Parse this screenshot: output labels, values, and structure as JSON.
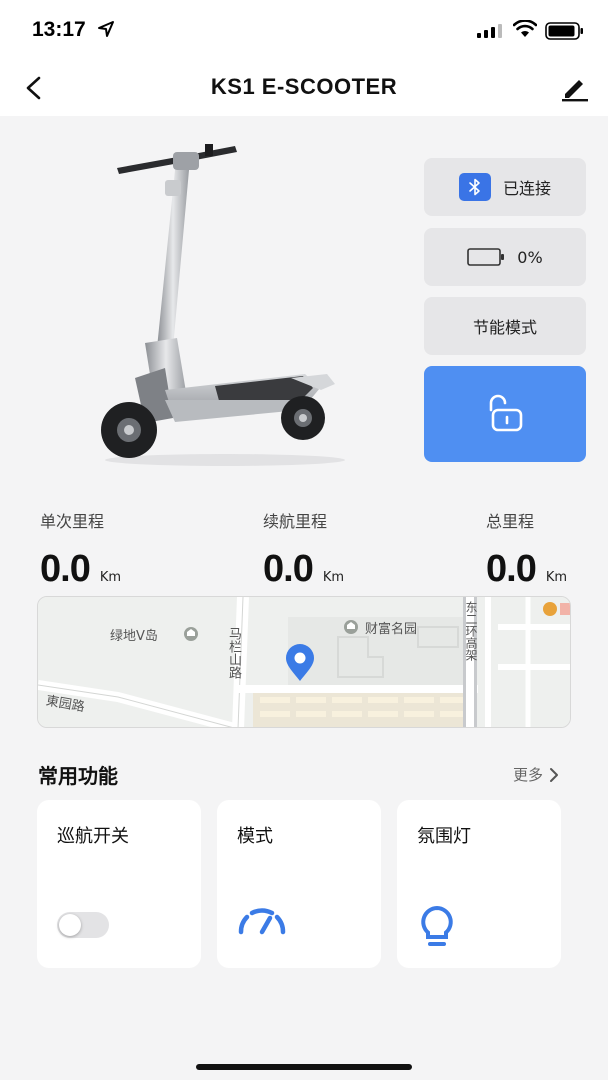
{
  "status_bar": {
    "time": "13:17"
  },
  "nav": {
    "title": "KS1 E-SCOOTER"
  },
  "device": {
    "bluetooth_status": "已连接",
    "battery_percent": "0%",
    "mode": "节能模式",
    "lock_state": "unlocked"
  },
  "stats": [
    {
      "label": "单次里程",
      "value": "0.0",
      "unit": "Km"
    },
    {
      "label": "续航里程",
      "value": "0.0",
      "unit": "Km"
    },
    {
      "label": "总里程",
      "value": "0.0",
      "unit": "Km"
    }
  ],
  "map": {
    "labels": {
      "lvdi": "绿地V岛",
      "caifu": "财富名园",
      "malan": "马栏山路",
      "yuyuan": "東园路",
      "gaojia": "东二环高架"
    }
  },
  "section": {
    "title": "常用功能",
    "more": "更多"
  },
  "features": [
    {
      "title": "巡航开关",
      "icon": "toggle-switch",
      "state": "off"
    },
    {
      "title": "模式",
      "icon": "speedometer-icon"
    },
    {
      "title": "氛围灯",
      "icon": "lightbulb-icon"
    }
  ],
  "colors": {
    "accent": "#4f8ff2",
    "bluetooth_badge": "#3a74e6",
    "map_pin": "#3b7be6"
  }
}
